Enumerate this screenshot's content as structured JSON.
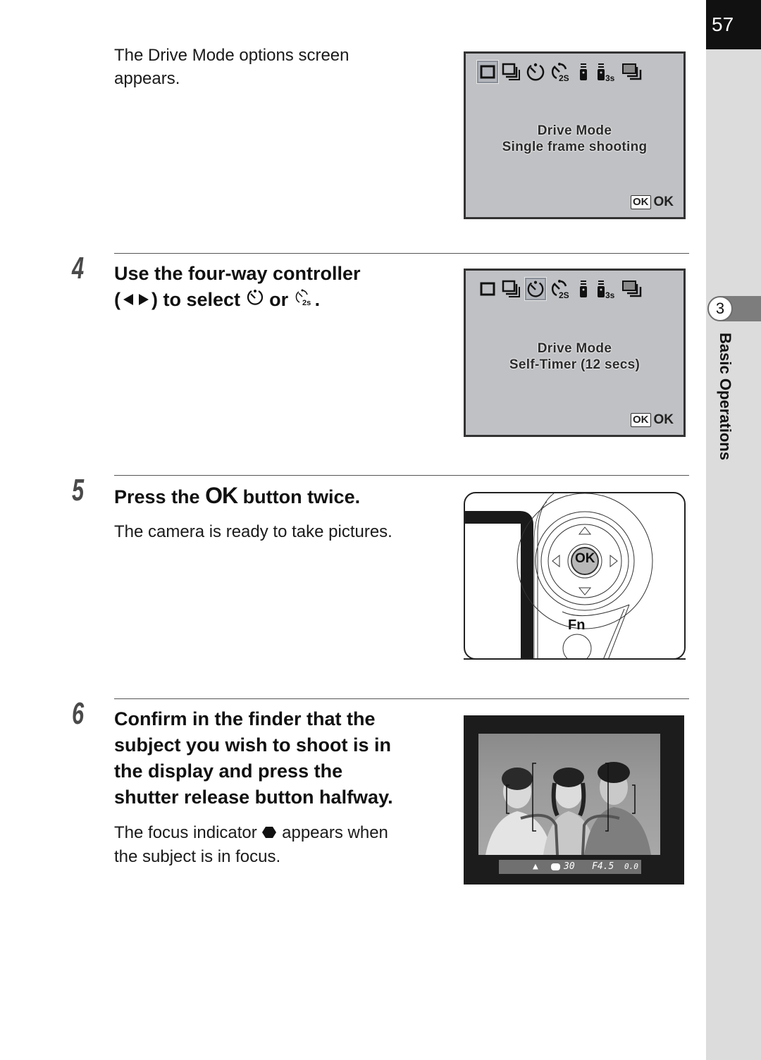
{
  "page": {
    "number": "57",
    "chapter_number": "3",
    "chapter_title": "Basic Operations"
  },
  "intro": {
    "text_line1": "The Drive Mode options screen",
    "text_line2": "appears."
  },
  "lcd_screens": [
    {
      "selected_icon": "single-frame",
      "title": "Drive Mode",
      "subtitle": "Single frame shooting",
      "ok_box": "OK",
      "ok_label": "OK"
    },
    {
      "selected_icon": "self-timer-12s",
      "title": "Drive Mode",
      "subtitle": "Self-Timer (12 secs)",
      "ok_box": "OK",
      "ok_label": "OK"
    }
  ],
  "drive_icons": [
    {
      "name": "single-frame",
      "suffix": ""
    },
    {
      "name": "continuous",
      "suffix": ""
    },
    {
      "name": "self-timer-12s",
      "suffix": ""
    },
    {
      "name": "self-timer-2s",
      "suffix": "2S"
    },
    {
      "name": "remote",
      "suffix": ""
    },
    {
      "name": "remote-3s",
      "suffix": "3s"
    },
    {
      "name": "bracket",
      "suffix": ""
    }
  ],
  "steps": [
    {
      "number": "4",
      "title_line1": "Use the four-way controller",
      "title_line2_prefix": "(",
      "title_line2_mid": ") to select",
      "title_line2_or": "or",
      "title_line2_suffix_icon": "2s",
      "title_line2_end": "."
    },
    {
      "number": "5",
      "title_prefix": "Press the",
      "title_ok": "OK",
      "title_suffix": "button twice.",
      "body": "The camera is ready to take pictures."
    },
    {
      "number": "6",
      "title_lines": [
        "Confirm in the finder that the",
        "subject you wish to shoot is in",
        "the display and press the",
        "shutter release button halfway."
      ],
      "body_prefix": "The focus indicator",
      "body_suffix": "appears when",
      "body_line2": "the subject is in focus."
    }
  ],
  "controller_illustration": {
    "center_label": "OK",
    "fn_label": "Fn"
  },
  "viewfinder": {
    "shutter": "30",
    "aperture": "F4.5",
    "exposure_comp": "0.0"
  }
}
